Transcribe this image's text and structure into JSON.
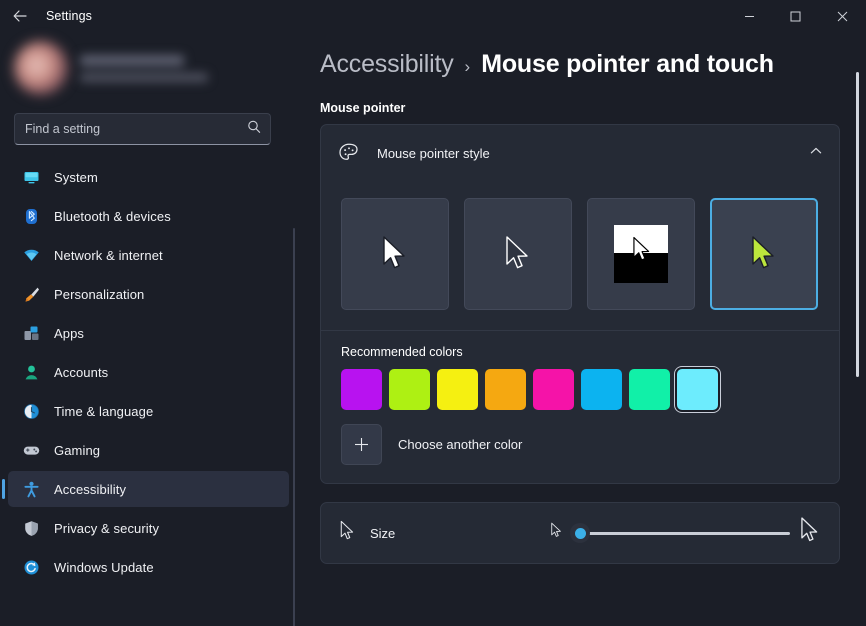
{
  "window": {
    "app_title": "Settings",
    "back_icon": "back-arrow-icon",
    "minimize_label": "–",
    "maximize_label": "□",
    "close_label": "✕"
  },
  "sidebar": {
    "search": {
      "placeholder": "Find a setting",
      "icon": "search-icon"
    },
    "items": [
      {
        "label": "System",
        "icon": "system-icon",
        "selected": false
      },
      {
        "label": "Bluetooth & devices",
        "icon": "bluetooth-icon",
        "selected": false
      },
      {
        "label": "Network & internet",
        "icon": "network-icon",
        "selected": false
      },
      {
        "label": "Personalization",
        "icon": "personalization-icon",
        "selected": false
      },
      {
        "label": "Apps",
        "icon": "apps-icon",
        "selected": false
      },
      {
        "label": "Accounts",
        "icon": "accounts-icon",
        "selected": false
      },
      {
        "label": "Time & language",
        "icon": "time-icon",
        "selected": false
      },
      {
        "label": "Gaming",
        "icon": "gaming-icon",
        "selected": false
      },
      {
        "label": "Accessibility",
        "icon": "accessibility-icon",
        "selected": true
      },
      {
        "label": "Privacy & security",
        "icon": "privacy-icon",
        "selected": false
      },
      {
        "label": "Windows Update",
        "icon": "update-icon",
        "selected": false
      }
    ]
  },
  "main": {
    "breadcrumb": {
      "parent": "Accessibility",
      "separator": "›",
      "current": "Mouse pointer and touch"
    },
    "section_heading": "Mouse pointer",
    "pointer_style_card": {
      "title": "Mouse pointer style",
      "icon": "palette-icon",
      "expand_icon": "chevron-up-icon",
      "expanded": true,
      "styles": [
        {
          "name": "white",
          "selected": false
        },
        {
          "name": "black",
          "selected": false
        },
        {
          "name": "inverted",
          "selected": false
        },
        {
          "name": "custom",
          "selected": true
        }
      ],
      "colors_label": "Recommended colors",
      "colors": [
        {
          "name": "purple",
          "hex": "#B812F0",
          "selected": false
        },
        {
          "name": "lime",
          "hex": "#AEF013",
          "selected": false
        },
        {
          "name": "yellow",
          "hex": "#F5F011",
          "selected": false
        },
        {
          "name": "orange",
          "hex": "#F5A811",
          "selected": false
        },
        {
          "name": "pink",
          "hex": "#F513A8",
          "selected": false
        },
        {
          "name": "blue",
          "hex": "#0CB3F0",
          "selected": false
        },
        {
          "name": "green",
          "hex": "#11F0A8",
          "selected": false
        },
        {
          "name": "light-cyan",
          "hex": "#6DECFD",
          "selected": true
        }
      ],
      "choose_another_color": "Choose another color",
      "plus_icon": "plus-icon"
    },
    "size_card": {
      "title": "Size",
      "icon": "small-pointer-icon",
      "slider_value": 0,
      "slider_min": 0,
      "slider_max": 100,
      "small_preview_icon": "small-pointer-icon",
      "large_preview_icon": "large-pointer-icon"
    }
  },
  "accent_color": "#4CAEE3",
  "custom_pointer_color": "#BCE63C"
}
